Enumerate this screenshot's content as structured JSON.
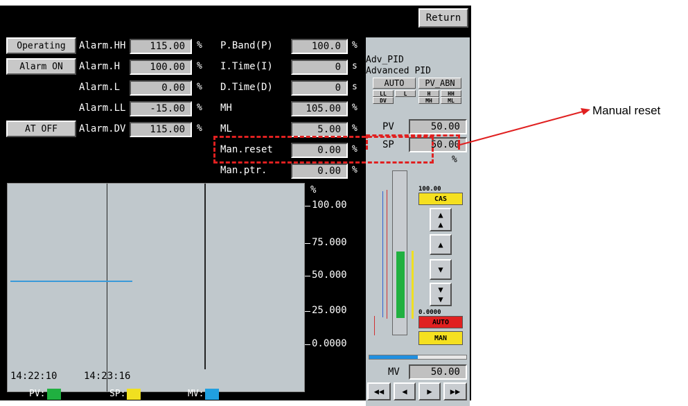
{
  "header": {
    "return_label": "Return"
  },
  "left_buttons": {
    "operating": "Operating",
    "alarm_on": "Alarm ON",
    "at_off": "AT OFF"
  },
  "alarms": [
    {
      "label": "Alarm.HH",
      "value": "115.00",
      "unit": "%"
    },
    {
      "label": "Alarm.H",
      "value": "100.00",
      "unit": "%"
    },
    {
      "label": "Alarm.L",
      "value": "0.00",
      "unit": "%"
    },
    {
      "label": "Alarm.LL",
      "value": "-15.00",
      "unit": "%"
    },
    {
      "label": "Alarm.DV",
      "value": "115.00",
      "unit": "%"
    }
  ],
  "params": [
    {
      "label": "P.Band(P)",
      "value": "100.0",
      "unit": "%"
    },
    {
      "label": "I.Time(I)",
      "value": "0",
      "unit": "s"
    },
    {
      "label": "D.Time(D)",
      "value": "0",
      "unit": "s"
    },
    {
      "label": "MH",
      "value": "105.00",
      "unit": "%"
    },
    {
      "label": "ML",
      "value": "5.00",
      "unit": "%"
    },
    {
      "label": "Man.reset",
      "value": "0.00",
      "unit": "%"
    },
    {
      "label": "Man.ptr.",
      "value": "0.00",
      "unit": "%"
    }
  ],
  "trend": {
    "unit": "%",
    "ticks": [
      "100.00",
      "75.000",
      "50.000",
      "25.000",
      "0.0000"
    ],
    "times": [
      "14:22:10",
      "14:23:16"
    ],
    "legend": [
      {
        "label": "PV:",
        "color": "#20b040"
      },
      {
        "label": "SP:",
        "color": "#f0e020"
      },
      {
        "label": "MV:",
        "color": "#20a0e0"
      }
    ],
    "pv_line_color": "#3a9ad9"
  },
  "faceplate": {
    "tag": "Adv_PID",
    "desc": "Advanced PID",
    "mode_label": "AUTO",
    "status_label": "PV_ABN",
    "alarm_lamps": [
      "LL",
      "L",
      "H",
      "HH",
      "DV",
      "MH",
      "ML"
    ],
    "pv_label": "PV",
    "pv_value": "50.00",
    "sp_label": "SP",
    "sp_value": "50.00",
    "unit": "%",
    "scale_high": "100.00",
    "scale_low": "0.0000",
    "cas_label": "CAS",
    "auto_label": "AUTO",
    "man_label": "MAN",
    "mv_label": "MV",
    "mv_value": "50.00",
    "pv_level": 0.5,
    "sp_level": 0.5,
    "mv_level": 0.5,
    "colors": {
      "cas": "#f5e020",
      "auto": "#e02020",
      "man": "#f5e020",
      "bar_pv": "#20b040",
      "bar_sp": "#f0e020"
    }
  },
  "annotation": {
    "label": "Manual reset",
    "color": "#e02020"
  }
}
